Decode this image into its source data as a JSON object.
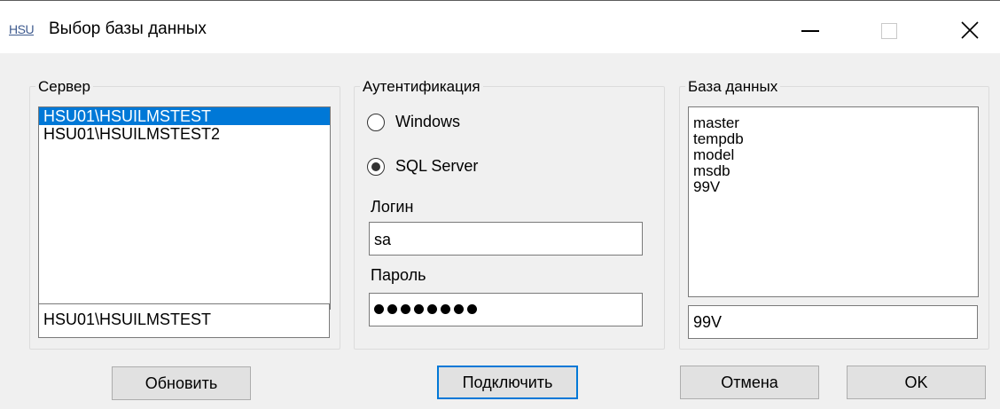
{
  "window": {
    "app_icon": "HSU",
    "title": "Выбор базы данных"
  },
  "server": {
    "legend": "Сервер",
    "items": [
      "HSU01\\HSUILMSTEST",
      "HSU01\\HSUILMSTEST2"
    ],
    "selected_index": 0,
    "value": "HSU01\\HSUILMSTEST"
  },
  "auth": {
    "legend": "Аутентификация",
    "windows_label": "Windows",
    "sql_label": "SQL Server",
    "selected": "SQL Server",
    "login_label": "Логин",
    "login_value": "sa",
    "password_label": "Пароль",
    "password_length": 8
  },
  "database": {
    "legend": "База данных",
    "items": [
      "master",
      "tempdb",
      "model",
      "msdb",
      "99V"
    ],
    "value": "99V"
  },
  "buttons": {
    "refresh": "Обновить",
    "connect": "Подключить",
    "cancel": "Отмена",
    "ok": "OK"
  },
  "colors": {
    "selection": "#0078d7",
    "window_bg": "#f0f0f0"
  }
}
